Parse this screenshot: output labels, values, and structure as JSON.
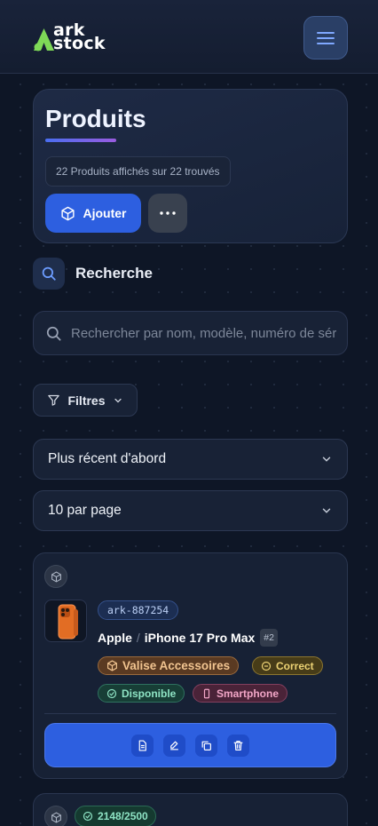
{
  "header": {
    "logo_line1": "ark",
    "logo_line2": "stock",
    "brand_color": "#7ed957",
    "menu_icon": "hamburger-menu-icon"
  },
  "products_panel": {
    "title": "Produits",
    "count_text": "22 Produits affichés sur 22 trouvés",
    "add_label": "Ajouter",
    "add_icon": "box-icon",
    "more_icon": "more-horizontal-icon",
    "accent_color": "#2d5fe0"
  },
  "search": {
    "heading": "Recherche",
    "placeholder": "Rechercher par nom, modèle, numéro de série..."
  },
  "filters": {
    "label": "Filtres",
    "sort_selected": "Plus récent d'abord",
    "per_page_selected": "10 par page"
  },
  "products": [
    {
      "sku": "ark-887254",
      "brand": "Apple",
      "separator": "/",
      "model": "iPhone 17 Pro Max",
      "number_badge": "#2",
      "tags": {
        "location": "Valise Accessoires",
        "condition": "Correct",
        "status": "Disponible",
        "category": "Smartphone"
      },
      "actions": [
        "document-icon",
        "edit-icon",
        "duplicate-icon",
        "trash-icon"
      ]
    },
    {
      "stock": "2148/2500"
    }
  ]
}
